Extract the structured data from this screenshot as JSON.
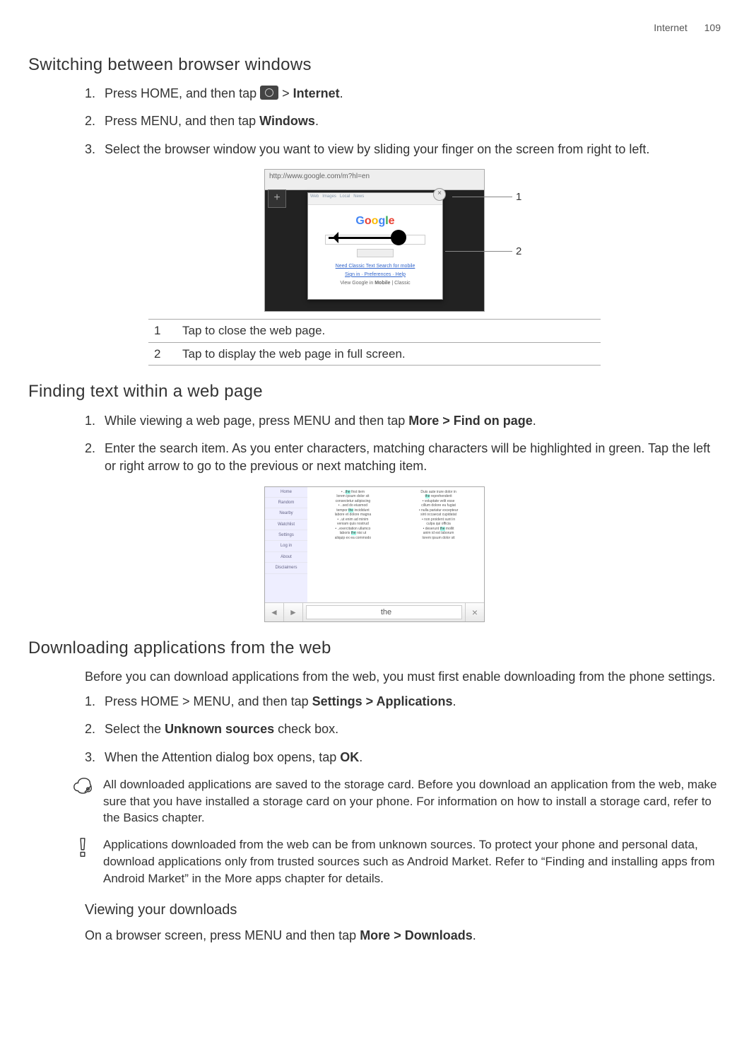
{
  "header": {
    "section": "Internet",
    "page_number": "109"
  },
  "section1": {
    "title": "Switching between browser windows",
    "steps": [
      {
        "num": "1.",
        "pre": "Press HOME, and then tap ",
        "post": " > ",
        "strong": "Internet",
        "end": "."
      },
      {
        "num": "2.",
        "pre": "Press MENU, and then tap ",
        "strong": "Windows",
        "end": "."
      },
      {
        "num": "3.",
        "text": "Select the browser window you want to view by sliding your finger on the screen from right to left."
      }
    ],
    "fig_url": "http://www.google.com/m?hl=en",
    "fig_callout1": "1",
    "fig_callout2": "2",
    "table": [
      {
        "n": "1",
        "t": "Tap to close the web page."
      },
      {
        "n": "2",
        "t": "Tap to display the web page in full screen."
      }
    ]
  },
  "section2": {
    "title": "Finding text within a web page",
    "steps": [
      {
        "num": "1.",
        "pre": "While viewing a web page, press MENU and then tap ",
        "strong": "More > Find on page",
        "end": "."
      },
      {
        "num": "2.",
        "text": "Enter the search item. As you enter characters, matching characters will be highlighted in green. Tap the left or right arrow to go to the previous or next matching item."
      }
    ],
    "find_input": "the"
  },
  "section3": {
    "title": "Downloading applications from the web",
    "intro": "Before you can download applications from the web, you must first enable downloading from the phone settings.",
    "steps": [
      {
        "num": "1.",
        "pre": "Press HOME > MENU, and then tap ",
        "strong": "Settings > Applications",
        "end": "."
      },
      {
        "num": "2.",
        "pre": "Select the ",
        "strong": "Unknown sources",
        "end": " check box."
      },
      {
        "num": "3.",
        "pre": "When the Attention dialog box opens, tap ",
        "strong": "OK",
        "end": "."
      }
    ],
    "note1": "All downloaded applications are saved to the storage card. Before you download an application from the web, make sure that you have installed a storage card on your phone. For information on how to install a storage card, refer to the Basics chapter.",
    "note2": "Applications downloaded from the web can be from unknown sources. To protect your phone and personal data, download applications only from trusted sources such as Android Market. Refer to “Finding and installing apps from Android Market” in the More apps chapter for details.",
    "sub_title": "Viewing your downloads",
    "sub_text_pre": "On a browser screen, press MENU and then tap ",
    "sub_strong": "More > Downloads",
    "sub_end": "."
  }
}
